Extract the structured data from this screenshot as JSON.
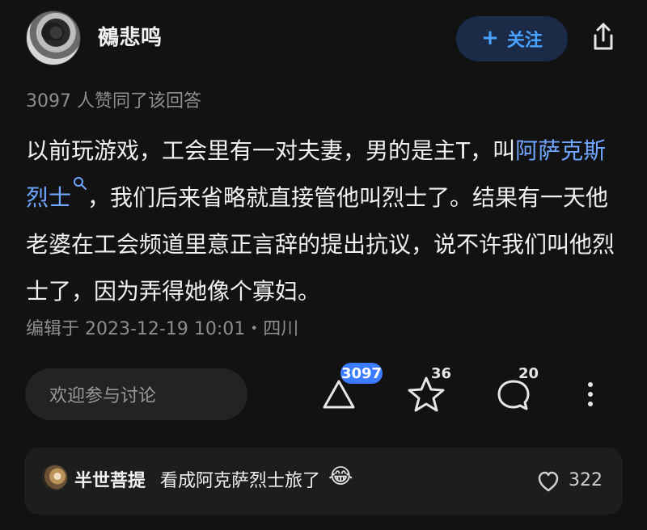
{
  "header": {
    "username": "鵺悲鸣",
    "follow": {
      "label": "关注",
      "icon": "plus-icon"
    },
    "share": {
      "icon": "share-icon"
    }
  },
  "summary": {
    "likes_text": "3097 人赞同了该回答"
  },
  "answer": {
    "text_before_link": "以前玩游戏，工会里有一对夫妻，男的是主T，叫",
    "link_text": "阿萨克斯烈士",
    "link_search_icon": "search-icon",
    "text_after_link": "，我们后来省略就直接管他叫烈士了。结果有一天他老婆在工会频道里意正言辞的提出抗议，说不许我们叫他烈士了，因为弄得她像个寡妇。"
  },
  "meta": {
    "edited_text": "编辑于 2023-12-19 10:01・四川"
  },
  "actions": {
    "comment_input_placeholder": "欢迎参与讨论",
    "upvote": {
      "icon": "upvote-icon",
      "count": "3097",
      "badge_color": "#3b7bff"
    },
    "favorite": {
      "icon": "star-icon",
      "count": "36"
    },
    "comments": {
      "icon": "comment-icon",
      "count": "20"
    },
    "more": {
      "icon": "more-vertical-icon"
    }
  },
  "featured_comment": {
    "username": "半世菩提",
    "text": "看成阿克萨烈士旅了",
    "emoji": "😂",
    "likes": {
      "icon": "heart-icon",
      "count": "322"
    }
  },
  "colors": {
    "background": "#121212",
    "text_primary": "#f0f0f0",
    "text_secondary": "#8e8e8e",
    "link": "#6fa6ff",
    "follow_bg": "#1b2a46",
    "follow_text": "#4aa3ff"
  }
}
